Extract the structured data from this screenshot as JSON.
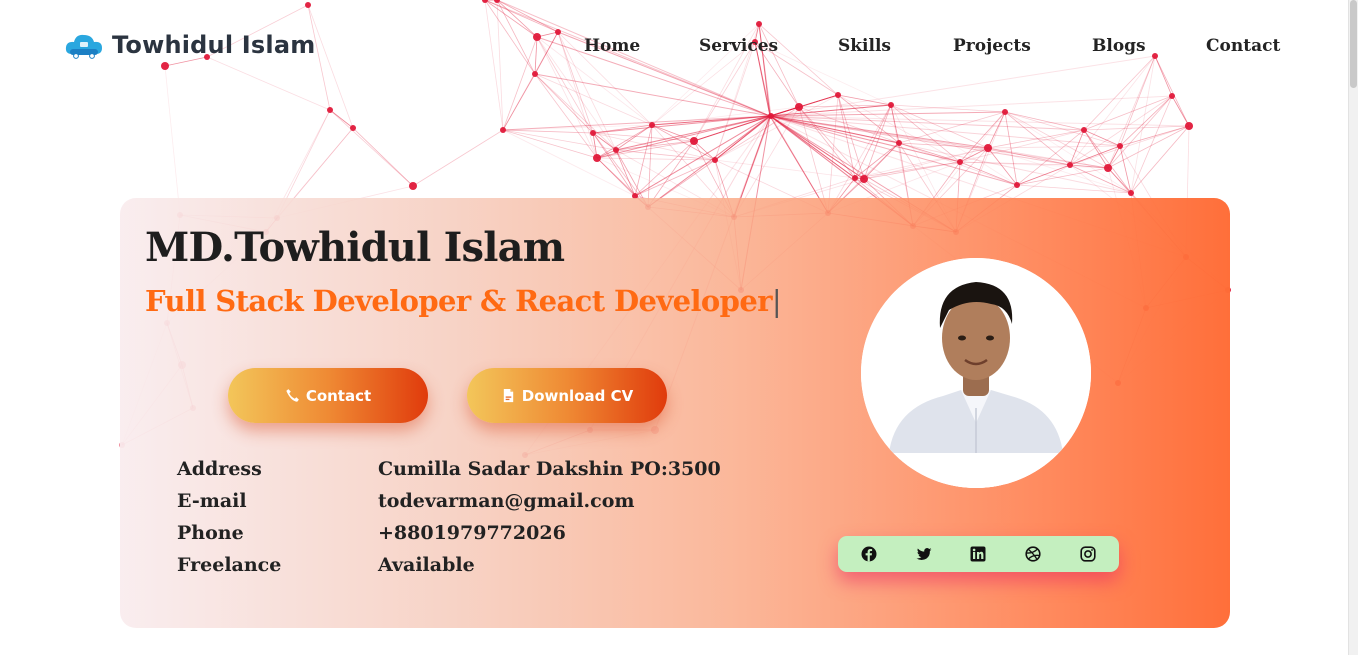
{
  "brand": {
    "name": "Towhidul Islam",
    "logo_icon": "cloud-logo-icon"
  },
  "nav": {
    "items": [
      {
        "label": "Home"
      },
      {
        "label": "Services"
      },
      {
        "label": "Skills"
      },
      {
        "label": "Projects"
      },
      {
        "label": "Blogs"
      },
      {
        "label": "Contact"
      }
    ]
  },
  "hero": {
    "name": "MD.Towhidul Islam",
    "role": "Full Stack Developer & React Developer",
    "role_cursor": "|",
    "contact_button": {
      "label": "Contact",
      "icon": "phone-icon"
    },
    "cv_button": {
      "label": "Download CV",
      "icon": "pdf-file-icon"
    },
    "info": [
      {
        "label": "Address",
        "value": "Cumilla Sadar Dakshin PO:3500"
      },
      {
        "label": "E-mail",
        "value": "todevarman@gmail.com"
      },
      {
        "label": "Phone",
        "value": "+8801979772026"
      },
      {
        "label": "Freelance",
        "value": "Available"
      }
    ]
  },
  "social": [
    "facebook-icon",
    "twitter-icon",
    "linkedin-icon",
    "dribbble-icon",
    "instagram-icon"
  ],
  "colors": {
    "accent_orange": "#ff6a13",
    "network_red": "#e0193a",
    "social_bar_bg": "#c4efbf",
    "text_dark": "#222222"
  }
}
